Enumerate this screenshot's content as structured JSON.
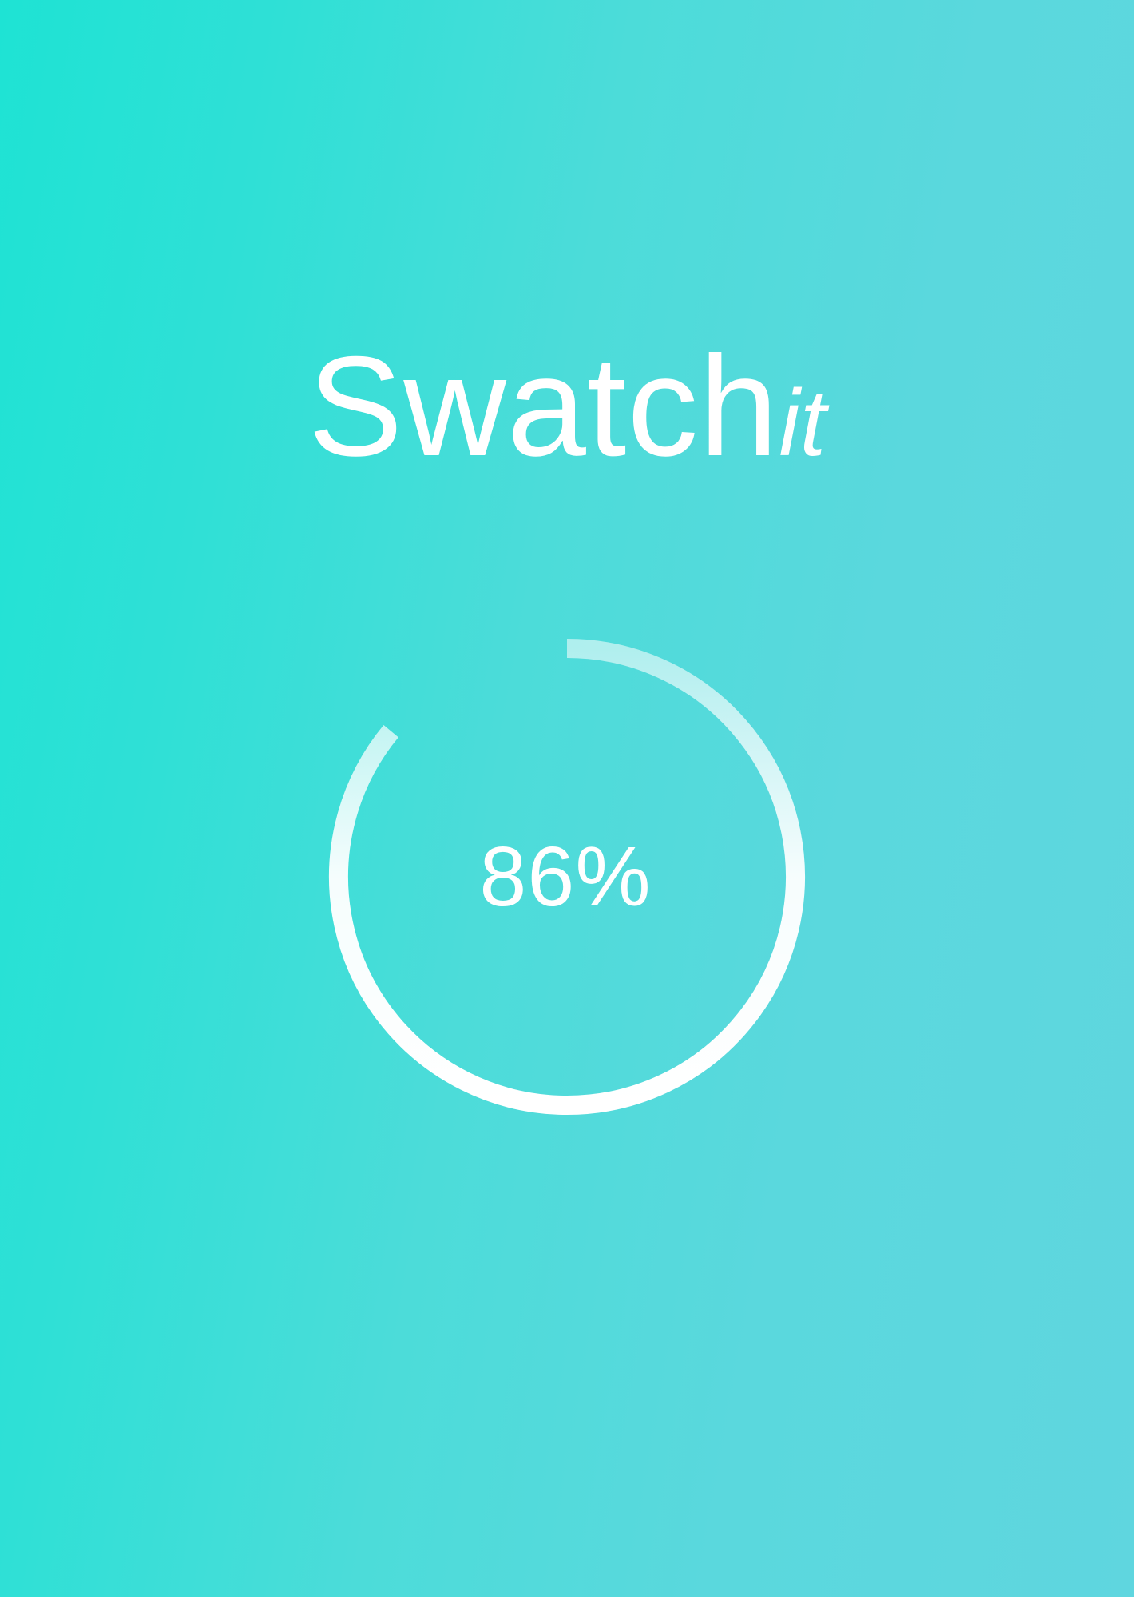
{
  "app": {
    "logo_main": "Swatch",
    "logo_suffix": "it"
  },
  "progress": {
    "value": 0.86,
    "label": "86%"
  },
  "colors": {
    "background_start": "#1ee3d4",
    "background_end": "#5fd6df",
    "foreground": "#ffffff"
  }
}
